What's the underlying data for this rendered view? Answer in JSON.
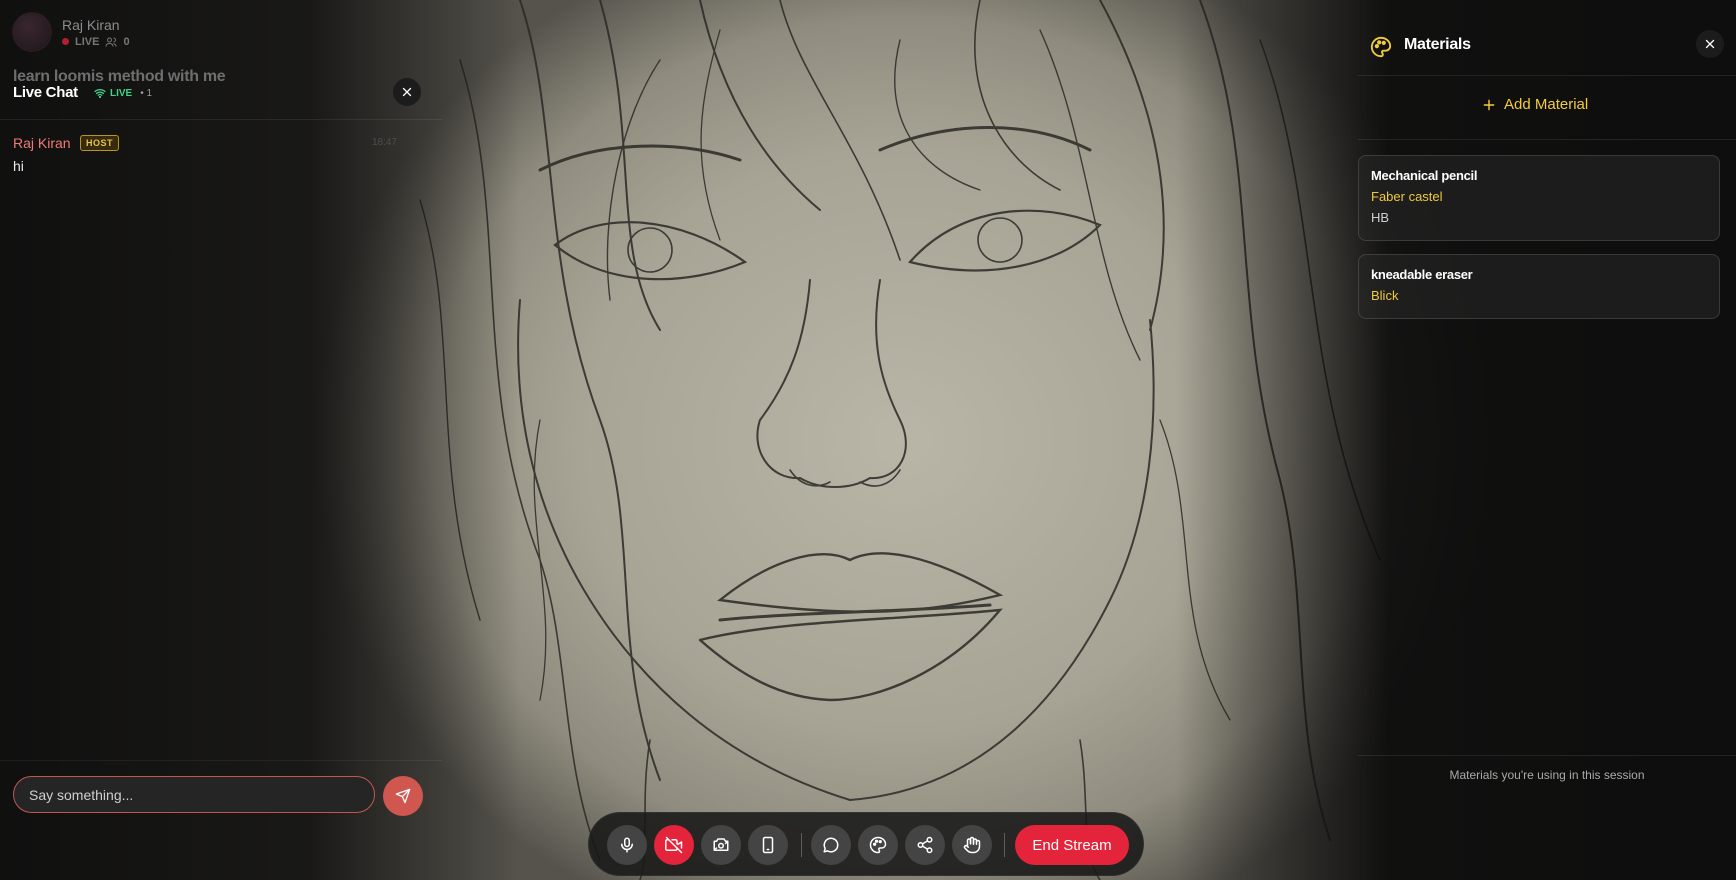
{
  "streamer": {
    "name": "Raj Kiran",
    "live_label": "LIVE",
    "viewer_count": "0",
    "stream_title": "learn loomis method with me"
  },
  "chat": {
    "title": "Live Chat",
    "live_label": "LIVE",
    "count": "• 1",
    "messages": [
      {
        "author": "Raj Kiran",
        "badge": "HOST",
        "time": "18:47",
        "text": "hi"
      }
    ],
    "input_placeholder": "Say something..."
  },
  "materials": {
    "title": "Materials",
    "add_label": "Add Material",
    "items": [
      {
        "name": "Mechanical pencil",
        "brand": "Faber castel",
        "detail": "HB"
      },
      {
        "name": "kneadable eraser",
        "brand": "Blick",
        "detail": ""
      }
    ],
    "footer": "Materials you're using in this session"
  },
  "controls": {
    "end_stream_label": "End Stream"
  },
  "colors": {
    "accent_red": "#e3243a",
    "accent_yellow": "#f3cc3e",
    "live_green": "#3fd28a",
    "chat_author": "#f07a78"
  },
  "icons": [
    "viewers-icon",
    "close-icon",
    "wifi-icon",
    "send-icon",
    "palette-icon",
    "plus-icon",
    "microphone-icon",
    "camera-off-icon",
    "switch-camera-icon",
    "phone-icon",
    "chat-icon",
    "share-icon",
    "hand-icon"
  ]
}
